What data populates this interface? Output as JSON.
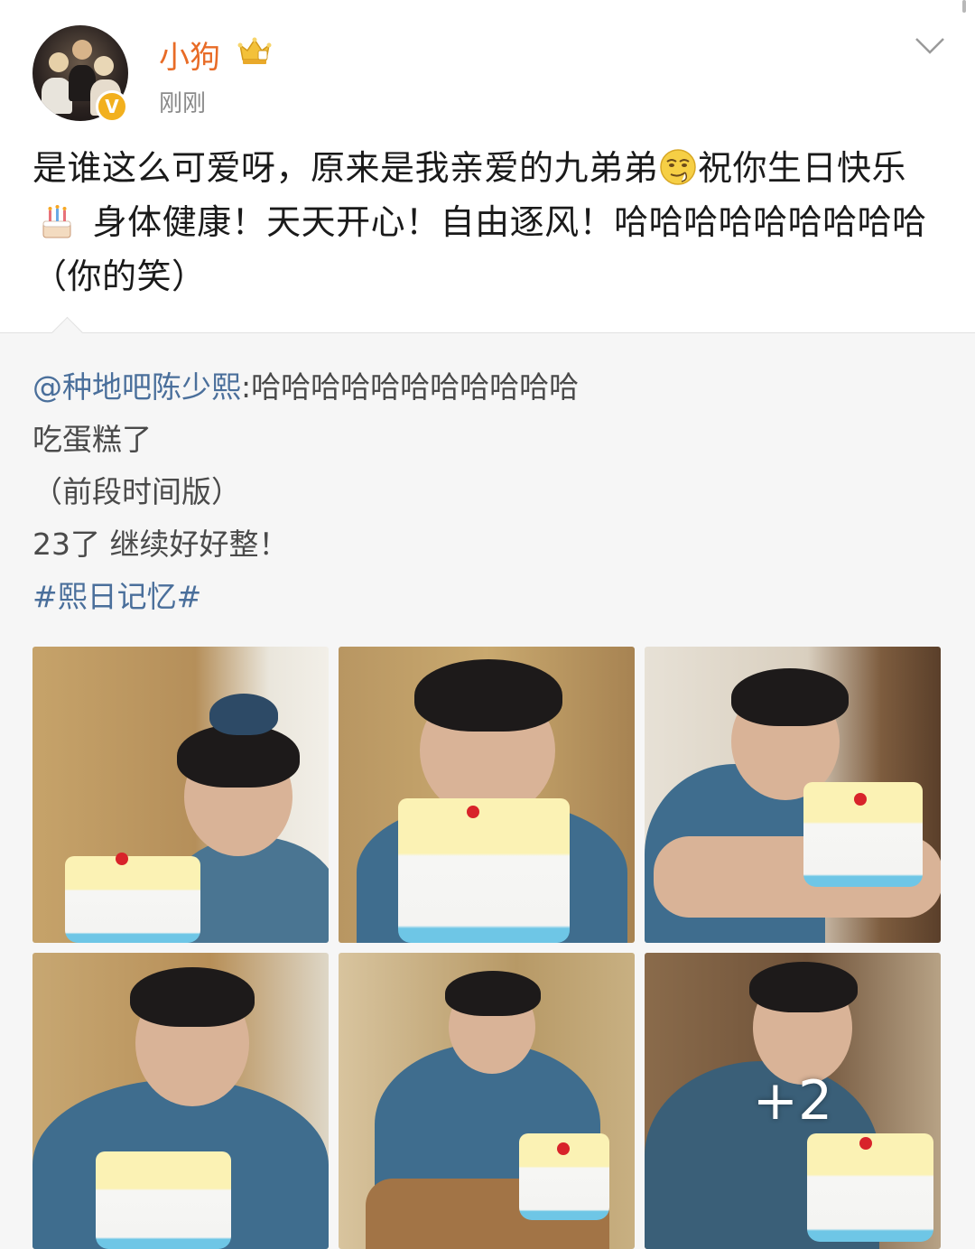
{
  "post": {
    "username": "小狗",
    "timestamp": "刚刚",
    "text_part1": "是谁这么可爱呀，原来是我亲爱的九弟弟",
    "text_part2": "祝你生日快乐",
    "text_part3": " 身体健康！天天开心！自由逐风！哈哈哈哈哈哈哈哈哈（你的笑）"
  },
  "repost": {
    "mention": "@种地吧陈少熙",
    "mention_text": ":哈哈哈哈哈哈哈哈哈哈哈",
    "line2": "吃蛋糕了",
    "line3": "（前段时间版）",
    "line4": "23了 继续好好整！",
    "hashtag": "#熙日记忆#"
  },
  "photos": {
    "more_count": "+2"
  },
  "colors": {
    "username": "#e86b26",
    "link": "#4a6f9b",
    "repost_bg": "#f6f6f6",
    "verified": "#f2b01e"
  },
  "icons": [
    "verified-badge-icon",
    "crown-member-icon",
    "chevron-down-icon",
    "smirk-emoji-icon",
    "cake-emoji-icon"
  ]
}
